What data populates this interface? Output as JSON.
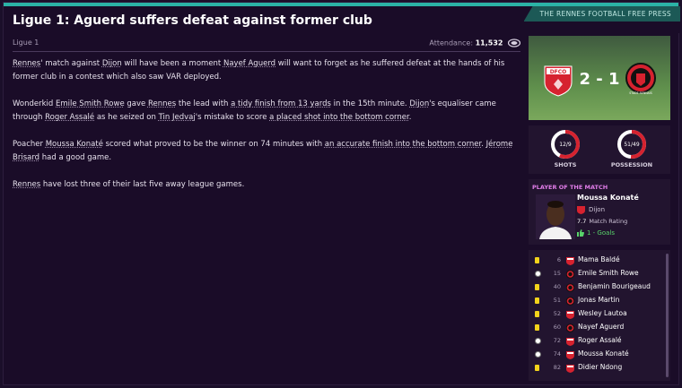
{
  "header": {
    "title": "Ligue 1: Aguerd suffers defeat against former club",
    "source": "THE RENNES FOOTBALL FREE PRESS"
  },
  "article": {
    "competition": "Ligue 1",
    "attendance_label": "Attendance:",
    "attendance_value": "11,532",
    "paragraphs": [
      [
        {
          "t": "Rennes",
          "u": true
        },
        {
          "t": "' match against ",
          "u": false
        },
        {
          "t": "Dijon",
          "u": true
        },
        {
          "t": " will have been a moment ",
          "u": false
        },
        {
          "t": "Nayef Aguerd",
          "u": true
        },
        {
          "t": " will want to forget as he suffered defeat at the hands of his former club in a contest which also saw VAR deployed.",
          "u": false
        }
      ],
      [
        {
          "t": "Wonderkid ",
          "u": false
        },
        {
          "t": "Emile Smith Rowe",
          "u": true
        },
        {
          "t": " gave ",
          "u": false
        },
        {
          "t": "Rennes",
          "u": true
        },
        {
          "t": " the lead with ",
          "u": false
        },
        {
          "t": "a tidy finish from 13 yards",
          "u": true
        },
        {
          "t": " in the 15th minute. ",
          "u": false
        },
        {
          "t": "Dijon",
          "u": true
        },
        {
          "t": "'s equaliser came through ",
          "u": false
        },
        {
          "t": "Roger Assalé",
          "u": true
        },
        {
          "t": " as he seized on ",
          "u": false
        },
        {
          "t": "Tin Jedvaj",
          "u": true
        },
        {
          "t": "'s mistake to score ",
          "u": false
        },
        {
          "t": "a placed shot into the bottom corner",
          "u": true
        },
        {
          "t": ".",
          "u": false
        }
      ],
      [
        {
          "t": "Poacher ",
          "u": false
        },
        {
          "t": "Moussa Konaté",
          "u": true
        },
        {
          "t": " scored what proved to be the winner on 74 minutes with ",
          "u": false
        },
        {
          "t": "an accurate finish into the bottom corner",
          "u": true
        },
        {
          "t": ". ",
          "u": false
        },
        {
          "t": "Jérome Brisard",
          "u": true
        },
        {
          "t": " had a good game.",
          "u": false
        }
      ],
      [
        {
          "t": "Rennes",
          "u": true
        },
        {
          "t": " have lost three of their last five away league games.",
          "u": false
        }
      ]
    ]
  },
  "scoreboard": {
    "home_badge_text": "DFCO",
    "away_badge_text": "STADE RENNAIS",
    "score": "2 - 1",
    "home_color": "#d6222f",
    "away_color": "#d6222f"
  },
  "stats": [
    {
      "label": "SHOTS",
      "value": "12/9",
      "home_fraction": 0.571
    },
    {
      "label": "POSSESSION",
      "value": "51/49",
      "home_fraction": 0.51
    }
  ],
  "potm": {
    "label": "PLAYER OF THE MATCH",
    "name": "Moussa Konaté",
    "club": "Dijon",
    "rating": "7.7",
    "rating_label": "Match Rating",
    "goals": "1 - Goals",
    "accent": "#e07de8"
  },
  "events": [
    {
      "type": "yellow-card",
      "minute": "6",
      "team": "dijon",
      "player": "Mama Baldé"
    },
    {
      "type": "goal",
      "minute": "15",
      "team": "rennes",
      "player": "Emile Smith Rowe"
    },
    {
      "type": "yellow-card",
      "minute": "40",
      "team": "rennes",
      "player": "Benjamin Bourigeaud"
    },
    {
      "type": "yellow-card",
      "minute": "51",
      "team": "rennes",
      "player": "Jonas Martin"
    },
    {
      "type": "yellow-card",
      "minute": "52",
      "team": "dijon",
      "player": "Wesley Lautoa"
    },
    {
      "type": "yellow-card",
      "minute": "60",
      "team": "rennes",
      "player": "Nayef Aguerd"
    },
    {
      "type": "goal",
      "minute": "72",
      "team": "dijon",
      "player": "Roger Assalé"
    },
    {
      "type": "goal",
      "minute": "74",
      "team": "dijon",
      "player": "Moussa Konaté"
    },
    {
      "type": "yellow-card",
      "minute": "82",
      "team": "dijon",
      "player": "Didier Ndong"
    }
  ]
}
